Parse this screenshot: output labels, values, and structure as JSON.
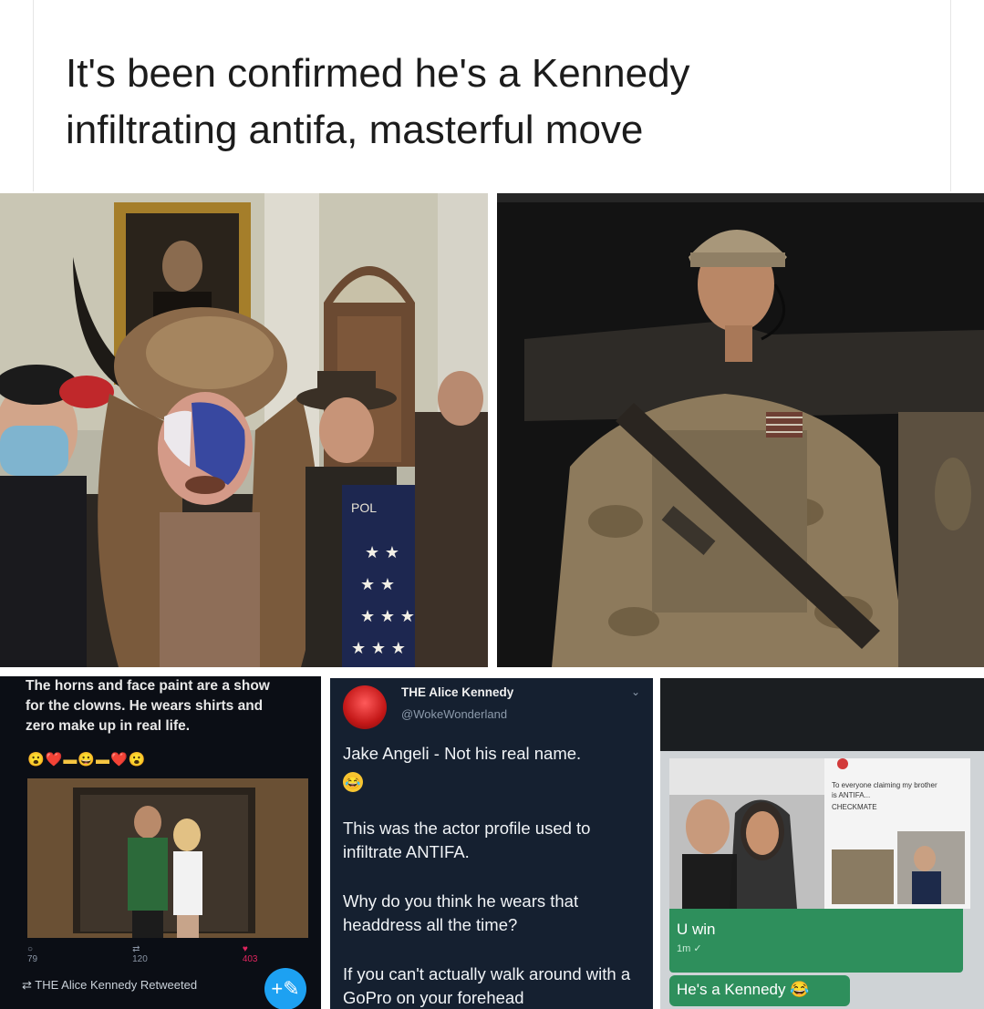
{
  "caption": {
    "line1": "It's been confirmed he's a Kennedy",
    "line2": "infiltrating antifa, masterful move"
  },
  "photos": {
    "left": {
      "flag_text": "POL"
    }
  },
  "panel1": {
    "line1": "The horns and face paint are a show",
    "line2": "for the clowns. He wears shirts and",
    "line3": "zero make up in real life.",
    "emojis": "😮❤️▬😀▬❤️😮",
    "replies": "79",
    "retweets": "120",
    "likes": "403",
    "retweeted_by": "THE Alice Kennedy Retweeted",
    "fab_icon": "+✎"
  },
  "panel2": {
    "name": "THE Alice Kennedy",
    "handle": "@WokeWonderland",
    "chevron": "⌄",
    "para1": "Jake Angeli - Not his real name.",
    "para1_emoji": "🤣",
    "para2": "This was the actor profile used to infiltrate ANTIFA.",
    "para3": "Why do you think he wears that headdress all the time?",
    "para4": "If you can't actually walk around with a GoPro on your forehead"
  },
  "panel3": {
    "note_line1": "To everyone claiming my brother",
    "note_line2": "is ANTIFA...",
    "note_line3": "CHECKMATE",
    "bubble1": "U win",
    "bubble1_meta": "1m",
    "bubble2": "He's a Kennedy 😂"
  }
}
